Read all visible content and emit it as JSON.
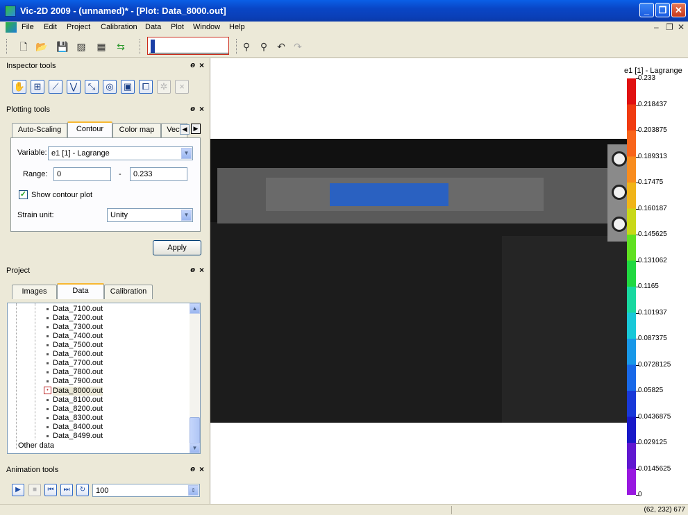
{
  "window": {
    "title": "Vic-2D 2009 - (unnamed)* - [Plot: Data_8000.out]"
  },
  "menu": [
    "File",
    "Edit",
    "Project",
    "Calibration",
    "Data",
    "Plot",
    "Window",
    "Help"
  ],
  "panels": {
    "inspector": "Inspector tools",
    "plotting": "Plotting tools",
    "project": "Project",
    "animation": "Animation tools"
  },
  "plotting_tabs": [
    "Auto-Scaling",
    "Contour",
    "Color map",
    "Vect"
  ],
  "contour": {
    "variable_label": "Variable:",
    "variable_value": "e1 [1] - Lagrange",
    "range_label": "Range:",
    "range_min": "0",
    "range_sep": "-",
    "range_max": "0.233",
    "show_contour_label": "Show contour plot",
    "show_contour_checked": true,
    "strain_unit_label": "Strain unit:",
    "strain_unit_value": "Unity",
    "apply_label": "Apply"
  },
  "project_tabs": [
    "Images",
    "Data",
    "Calibration"
  ],
  "project_files": [
    "Data_7100.out",
    "Data_7200.out",
    "Data_7300.out",
    "Data_7400.out",
    "Data_7500.out",
    "Data_7600.out",
    "Data_7700.out",
    "Data_7800.out",
    "Data_7900.out",
    "Data_8000.out",
    "Data_8100.out",
    "Data_8200.out",
    "Data_8300.out",
    "Data_8400.out",
    "Data_8499.out"
  ],
  "selected_file": "Data_8000.out",
  "other_data_label": "Other data",
  "animation": {
    "speed_value": "100"
  },
  "colorbar": {
    "title": "e1 [1] - Lagrange",
    "labels": [
      "0.233",
      "0.218437",
      "0.203875",
      "0.189313",
      "0.17475",
      "0.160187",
      "0.145625",
      "0.131062",
      "0.1165",
      "0.101937",
      "0.087375",
      "0.0728125",
      "0.05825",
      "0.0436875",
      "0.029125",
      "0.0145625",
      "0"
    ],
    "colors": [
      "#e01010",
      "#f03a10",
      "#f8641a",
      "#f88c1e",
      "#f0b418",
      "#c8d818",
      "#60e020",
      "#20d840",
      "#18d8a0",
      "#18c8d8",
      "#1898e8",
      "#1868e8",
      "#1838d8",
      "#1818c8",
      "#6018d0",
      "#9818e0",
      "#c818f0"
    ]
  },
  "status": {
    "coords": "(62, 232) 677"
  },
  "colors": {
    "roi": "#1f5fd0",
    "xp_title": "#0a46c6"
  }
}
